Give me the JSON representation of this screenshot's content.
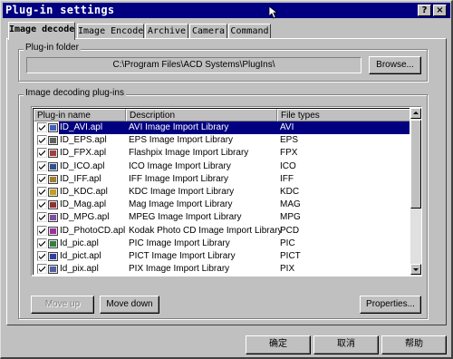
{
  "window": {
    "title": "Plug-in settings"
  },
  "titlebar": {
    "help_label": "?",
    "close_label": "×"
  },
  "tabs": [
    {
      "label": "Image decode",
      "active": true
    },
    {
      "label": "Image Encode",
      "active": false
    },
    {
      "label": "Archive",
      "active": false
    },
    {
      "label": "Camera",
      "active": false
    },
    {
      "label": "Command",
      "active": false
    }
  ],
  "plugin_folder": {
    "group_label": "Plug-in folder",
    "path": "C:\\Program Files\\ACD Systems\\PlugIns\\",
    "browse_label": "Browse..."
  },
  "decoding": {
    "group_label": "Image decoding plug-ins",
    "columns": [
      "Plug-in name",
      "Description",
      "File types"
    ],
    "rows": [
      {
        "name": "ID_AVI.apl",
        "description": "AVI Image Import Library",
        "types": "AVI",
        "checked": true,
        "selected": true,
        "icon": "plugin-file-icon",
        "icon_color": "#4060c0"
      },
      {
        "name": "ID_EPS.apl",
        "description": "EPS Image Import Library",
        "types": "EPS",
        "checked": true,
        "selected": false,
        "icon": "plugin-file-icon",
        "icon_color": "#606060"
      },
      {
        "name": "ID_FPX.apl",
        "description": "Flashpix Image Import Library",
        "types": "FPX",
        "checked": true,
        "selected": false,
        "icon": "plugin-file-icon",
        "icon_color": "#a04040"
      },
      {
        "name": "ID_ICO.apl",
        "description": "ICO Image Import Library",
        "types": "ICO",
        "checked": true,
        "selected": false,
        "icon": "plugin-file-icon",
        "icon_color": "#305090"
      },
      {
        "name": "ID_IFF.apl",
        "description": "IFF Image Import Library",
        "types": "IFF",
        "checked": true,
        "selected": false,
        "icon": "plugin-file-icon",
        "icon_color": "#a08030"
      },
      {
        "name": "ID_KDC.apl",
        "description": "KDC Image Import Library",
        "types": "KDC",
        "checked": true,
        "selected": false,
        "icon": "plugin-file-icon",
        "icon_color": "#c0a020"
      },
      {
        "name": "ID_Mag.apl",
        "description": "Mag Image Import Library",
        "types": "MAG",
        "checked": true,
        "selected": false,
        "icon": "plugin-file-icon",
        "icon_color": "#903030"
      },
      {
        "name": "ID_MPG.apl",
        "description": "MPEG Image Import Library",
        "types": "MPG",
        "checked": true,
        "selected": false,
        "icon": "plugin-file-icon",
        "icon_color": "#8050a0"
      },
      {
        "name": "ID_PhotoCD.apl",
        "description": "Kodak Photo CD Image Import Library",
        "types": "PCD",
        "checked": true,
        "selected": false,
        "icon": "plugin-file-icon",
        "icon_color": "#a030a0"
      },
      {
        "name": "Id_pic.apl",
        "description": "PIC Image Import Library",
        "types": "PIC",
        "checked": true,
        "selected": false,
        "icon": "plugin-file-icon",
        "icon_color": "#308040"
      },
      {
        "name": "Id_pict.apl",
        "description": "PICT Image Import Library",
        "types": "PICT",
        "checked": true,
        "selected": false,
        "icon": "plugin-file-icon",
        "icon_color": "#3040a0"
      },
      {
        "name": "Id_pix.apl",
        "description": "PIX Image Import Library",
        "types": "PIX",
        "checked": true,
        "selected": false,
        "icon": "plugin-file-icon",
        "icon_color": "#5060a0"
      }
    ],
    "move_up_label": "Move up",
    "move_down_label": "Move down",
    "properties_label": "Properties..."
  },
  "footer": {
    "ok_label": "确定",
    "cancel_label": "取消",
    "help_label": "帮助"
  }
}
